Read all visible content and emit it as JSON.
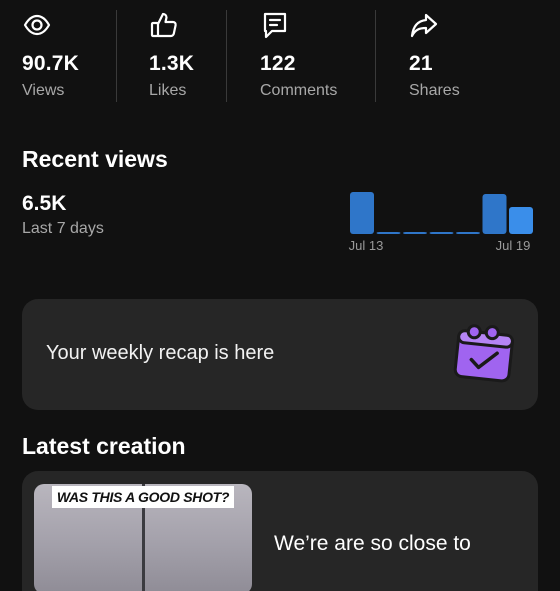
{
  "stats": [
    {
      "icon": "eye-icon",
      "value": "90.7K",
      "label": "Views"
    },
    {
      "icon": "thumbs-up-icon",
      "value": "1.3K",
      "label": "Likes"
    },
    {
      "icon": "comment-icon",
      "value": "122",
      "label": "Comments"
    },
    {
      "icon": "share-icon",
      "value": "21",
      "label": "Shares"
    }
  ],
  "recent_views": {
    "title": "Recent views",
    "value": "6.5K",
    "subtitle": "Last 7 days"
  },
  "chart_data": {
    "type": "bar",
    "categories": [
      "Jul 13",
      "",
      "",
      "",
      "",
      "",
      "Jul 19"
    ],
    "tick_labels": [
      "Jul 13",
      "Jul 19"
    ],
    "series": [
      {
        "values": [
          42,
          2,
          1,
          1,
          2,
          40,
          27
        ]
      }
    ],
    "ylim": [
      0,
      44
    ],
    "grid": false,
    "colors": {
      "bar": "#2f76c9",
      "bar_highlight": "#3a8eea",
      "tick_label": "#9a9a9a"
    }
  },
  "recap": {
    "text": "Your weekly recap is here",
    "icon": "calendar-check-icon",
    "icon_color": "#a064f0"
  },
  "latest_creation": {
    "title": "Latest creation",
    "thumbnail_caption": "WAS THIS A GOOD SHOT?",
    "video_title": "We’re are so close to"
  },
  "colors": {
    "background": "#111111",
    "card": "#262626",
    "muted_text": "#a8a8a8"
  }
}
